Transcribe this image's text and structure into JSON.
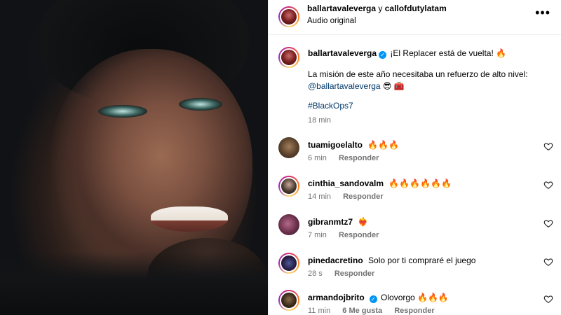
{
  "header": {
    "user1": "ballartavaleverga",
    "connector": "y",
    "user2": "callofdutylatam",
    "audio": "Audio original",
    "more_icon": "more-horizontal-icon"
  },
  "post": {
    "username": "ballartavaleverga",
    "headline": "¡El Replacer está de vuelta! 🔥",
    "body": "La misión de este año necesitaba un refuerzo de alto nivel:",
    "mention": "@ballartavaleverga",
    "emojis": "😎 🧰",
    "hashtag": "#BlackOps7",
    "time": "18 min"
  },
  "comments": [
    {
      "username": "tuamigoelalto",
      "text": "🔥🔥🔥",
      "time": "6 min",
      "likes": "",
      "reply": "Responder",
      "verified": false
    },
    {
      "username": "cinthia_sandovalm",
      "text": "🔥🔥🔥🔥🔥🔥",
      "time": "14 min",
      "likes": "",
      "reply": "Responder",
      "verified": false
    },
    {
      "username": "gibranmtz7",
      "text": "❤️‍🔥",
      "time": "7 min",
      "likes": "",
      "reply": "Responder",
      "verified": false
    },
    {
      "username": "pinedacretino",
      "text": "Solo por ti compraré el juego",
      "time": "28 s",
      "likes": "",
      "reply": "Responder",
      "verified": false
    },
    {
      "username": "armandojbrito",
      "text": "Olovorgo 🔥🔥🔥",
      "time": "11 min",
      "likes": "6 Me gusta",
      "reply": "Responder",
      "verified": true
    }
  ],
  "colors": {
    "link": "#00376b",
    "verified": "#0095f6",
    "secondary_text": "#737373"
  }
}
